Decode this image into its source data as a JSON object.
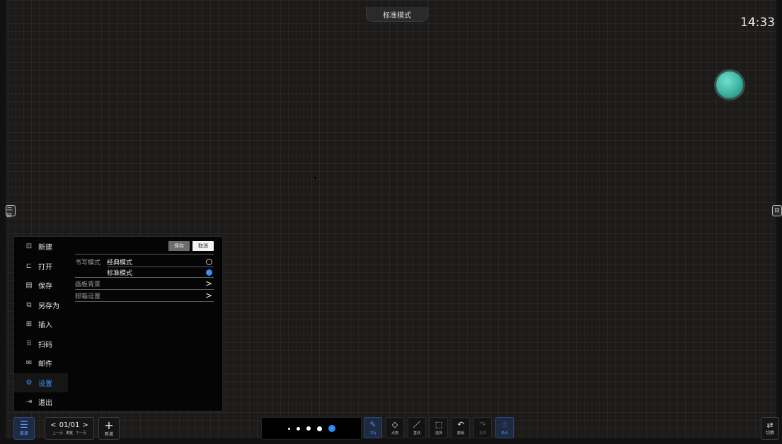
{
  "header": {
    "mode_title": "标准模式",
    "clock": "14:33"
  },
  "side_handles": {
    "left_icon": "三⊟",
    "right_icon": "⊟"
  },
  "menu": {
    "items": [
      {
        "icon": "⊡",
        "label": "新建"
      },
      {
        "icon": "⊏",
        "label": "打开"
      },
      {
        "icon": "▤",
        "label": "保存"
      },
      {
        "icon": "⧉",
        "label": "另存为"
      },
      {
        "icon": "⊞",
        "label": "插入"
      },
      {
        "icon": "⠿",
        "label": "扫码"
      },
      {
        "icon": "✉",
        "label": "邮件"
      },
      {
        "icon": "⚙",
        "label": "设置"
      },
      {
        "icon": "⇥",
        "label": "退出"
      }
    ],
    "active_item": "设置"
  },
  "settings": {
    "save_label": "保存",
    "cancel_label": "取消",
    "write_mode_label": "书写模式",
    "classic_mode": "经典模式",
    "standard_mode": "标准模式",
    "selected_mode": "标准模式",
    "board_bg": "画板背景",
    "mail_settings": "邮箱设置"
  },
  "toolbar": {
    "menu_label": "菜单",
    "page_indicator": "01/01",
    "prev_label": "上一页",
    "browse_label": "浏览",
    "next_label": "下一页",
    "new_label": "新增",
    "tools": [
      {
        "icon": "pen-icon",
        "glyph": "✎",
        "label": "书写",
        "state": "active"
      },
      {
        "icon": "eraser-icon",
        "glyph": "◇",
        "label": "点擦",
        "state": "normal"
      },
      {
        "icon": "line-icon",
        "glyph": "／",
        "label": "直线",
        "state": "normal"
      },
      {
        "icon": "select-icon",
        "glyph": "⬚",
        "label": "选择",
        "state": "normal"
      },
      {
        "icon": "undo-icon",
        "glyph": "↶",
        "label": "撤销",
        "state": "normal"
      },
      {
        "icon": "redo-icon",
        "glyph": "↷",
        "label": "重做",
        "state": "disabled"
      },
      {
        "icon": "touch-icon",
        "glyph": "☝",
        "label": "单点",
        "state": "active"
      }
    ],
    "switch_label": "切换"
  },
  "colors": {
    "accent": "#3b8df2",
    "float_ball": "#3bb3a1"
  }
}
